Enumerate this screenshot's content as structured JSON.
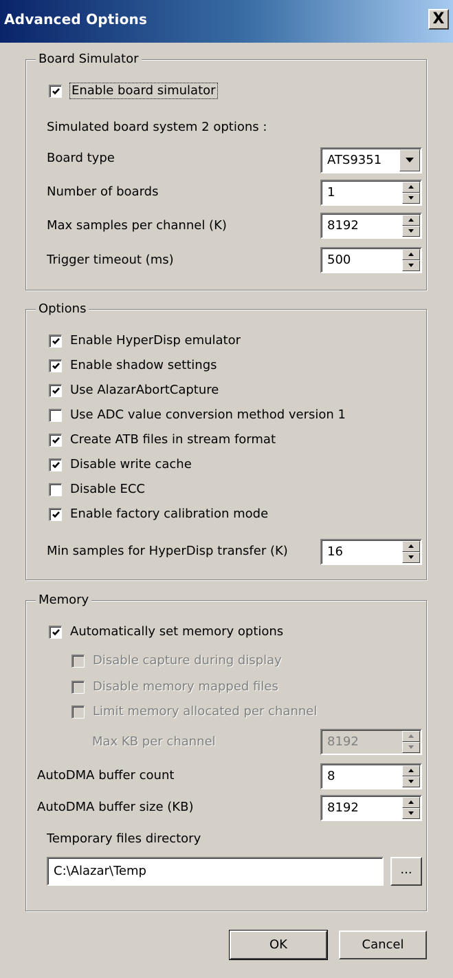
{
  "dialog": {
    "title": "Advanced Options",
    "close_glyph": "X"
  },
  "board_simulator": {
    "group_label": "Board Simulator",
    "enable_checkbox": {
      "label": "Enable board simulator",
      "checked": true
    },
    "system_text": "Simulated board system 2 options :",
    "board_type": {
      "label": "Board type",
      "value": "ATS9351"
    },
    "num_boards": {
      "label": "Number of boards",
      "value": "1"
    },
    "max_samples": {
      "label": "Max samples per channel (K)",
      "value": "8192"
    },
    "trigger_timeout": {
      "label": "Trigger timeout (ms)",
      "value": "500"
    }
  },
  "options": {
    "group_label": "Options",
    "checkboxes": [
      {
        "label": "Enable HyperDisp emulator",
        "checked": true
      },
      {
        "label": "Enable shadow settings",
        "checked": true
      },
      {
        "label": "Use AlazarAbortCapture",
        "checked": true
      },
      {
        "label": "Use ADC value conversion method version 1",
        "checked": false
      },
      {
        "label": "Create ATB files in stream format",
        "checked": true
      },
      {
        "label": "Disable write cache",
        "checked": true
      },
      {
        "label": "Disable ECC",
        "checked": false
      },
      {
        "label": "Enable factory calibration mode",
        "checked": true
      }
    ],
    "min_samples": {
      "label": "Min samples for HyperDisp transfer (K)",
      "value": "16"
    }
  },
  "memory": {
    "group_label": "Memory",
    "auto_checkbox": {
      "label": "Automatically set memory options",
      "checked": true
    },
    "disabled_checkboxes": [
      {
        "label": "Disable capture during display",
        "checked": false
      },
      {
        "label": "Disable memory mapped files",
        "checked": false
      },
      {
        "label": "Limit memory allocated per channel",
        "checked": false
      }
    ],
    "max_kb": {
      "label": "Max KB per channel",
      "value": "8192"
    },
    "autodma_count": {
      "label": "AutoDMA buffer count",
      "value": "8"
    },
    "autodma_size": {
      "label": "AutoDMA buffer size (KB)",
      "value": "8192"
    },
    "temp_dir": {
      "label": "Temporary files directory",
      "value": "C:\\Alazar\\Temp",
      "browse_label": "..."
    }
  },
  "buttons": {
    "ok": "OK",
    "cancel": "Cancel"
  }
}
